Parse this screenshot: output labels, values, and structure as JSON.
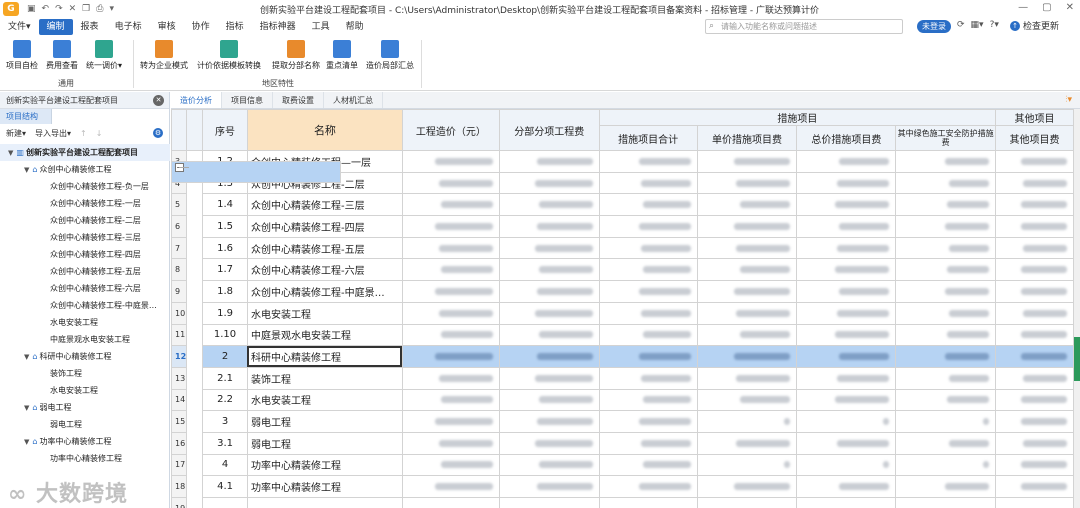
{
  "titlebar": {
    "app_title": "创新实验平台建设工程配套项目 - C:\\Users\\Administrator\\Desktop\\创新实验平台建设工程配套项目备案资料 - 招标管理 - 广联达预算计价"
  },
  "menu": {
    "items": [
      "文件▾",
      "编制",
      "报表",
      "电子标",
      "审核",
      "协作",
      "指标",
      "指标神器",
      "工具",
      "帮助"
    ],
    "active_index": 1
  },
  "search": {
    "placeholder": "请输入功能名称或问题描述"
  },
  "account": {
    "login_label": "未登录",
    "update_label": "检查更新"
  },
  "ribbon": {
    "buttons": [
      "项目自检",
      "费用查看",
      "统一调价▾",
      "转为企业模式",
      "计价依据模板转换",
      "提取分部名称",
      "重点清单",
      "造价局部汇总"
    ],
    "groups": [
      "通用",
      "地区特性"
    ]
  },
  "left_panel": {
    "project_title": "创新实验平台建设工程配套项目",
    "tab_label": "项目结构",
    "toolbar": {
      "new_label": "新建▾",
      "import_label": "导入导出▾"
    },
    "tree": [
      {
        "label": "创新实验平台建设工程配套项目",
        "level": 0,
        "kind": "root"
      },
      {
        "label": "众创中心精装修工程",
        "level": 1,
        "kind": "folder"
      },
      {
        "label": "众创中心精装修工程-负一层",
        "level": 2,
        "kind": "leaf"
      },
      {
        "label": "众创中心精装修工程-一层",
        "level": 2,
        "kind": "leaf"
      },
      {
        "label": "众创中心精装修工程-二层",
        "level": 2,
        "kind": "leaf"
      },
      {
        "label": "众创中心精装修工程-三层",
        "level": 2,
        "kind": "leaf"
      },
      {
        "label": "众创中心精装修工程-四层",
        "level": 2,
        "kind": "leaf"
      },
      {
        "label": "众创中心精装修工程-五层",
        "level": 2,
        "kind": "leaf"
      },
      {
        "label": "众创中心精装修工程-六层",
        "level": 2,
        "kind": "leaf"
      },
      {
        "label": "众创中心精装修工程-中庭景…",
        "level": 2,
        "kind": "leaf"
      },
      {
        "label": "水电安装工程",
        "level": 2,
        "kind": "leaf"
      },
      {
        "label": "中庭景观水电安装工程",
        "level": 2,
        "kind": "leaf"
      },
      {
        "label": "科研中心精装修工程",
        "level": 1,
        "kind": "folder"
      },
      {
        "label": "装饰工程",
        "level": 2,
        "kind": "leaf"
      },
      {
        "label": "水电安装工程",
        "level": 2,
        "kind": "leaf"
      },
      {
        "label": "弱电工程",
        "level": 1,
        "kind": "folder"
      },
      {
        "label": "弱电工程",
        "level": 2,
        "kind": "leaf"
      },
      {
        "label": "功率中心精装修工程",
        "level": 1,
        "kind": "folder"
      },
      {
        "label": "功率中心精装修工程",
        "level": 2,
        "kind": "leaf"
      }
    ]
  },
  "watermark": {
    "text": "大数跨境"
  },
  "right_tabs": [
    "造价分析",
    "项目信息",
    "取费设置",
    "人材机汇总"
  ],
  "grid": {
    "headers": {
      "seq": "序号",
      "name": "名称",
      "cost": "工程造价（元）",
      "subitem": "分部分项工程费",
      "measures_group": "措施项目",
      "measures_total": "措施项目合计",
      "unit_measures": "单价措施项目费",
      "total_measures": "总价措施项目费",
      "safety": "其中绿色施工安全防护措施费",
      "other_group": "其他项目",
      "other": "其他项目费"
    },
    "rows": [
      {
        "rn": "3",
        "seq": "1.2",
        "name": "众创中心精装修工程—一层",
        "group": false
      },
      {
        "rn": "4",
        "seq": "1.3",
        "name": "众创中心精装修工程-二层",
        "group": false
      },
      {
        "rn": "5",
        "seq": "1.4",
        "name": "众创中心精装修工程-三层",
        "group": false
      },
      {
        "rn": "6",
        "seq": "1.5",
        "name": "众创中心精装修工程-四层",
        "group": false
      },
      {
        "rn": "7",
        "seq": "1.6",
        "name": "众创中心精装修工程-五层",
        "group": false
      },
      {
        "rn": "8",
        "seq": "1.7",
        "name": "众创中心精装修工程-六层",
        "group": false
      },
      {
        "rn": "9",
        "seq": "1.8",
        "name": "众创中心精装修工程-中庭景…",
        "group": false
      },
      {
        "rn": "10",
        "seq": "1.9",
        "name": "水电安装工程",
        "group": false
      },
      {
        "rn": "11",
        "seq": "1.10",
        "name": "中庭景观水电安装工程",
        "group": false
      },
      {
        "rn": "12",
        "seq": "2",
        "name": "科研中心精装修工程",
        "group": true,
        "selected": true
      },
      {
        "rn": "13",
        "seq": "2.1",
        "name": "装饰工程",
        "group": false
      },
      {
        "rn": "14",
        "seq": "2.2",
        "name": "水电安装工程",
        "group": false
      },
      {
        "rn": "15",
        "seq": "3",
        "name": "弱电工程",
        "group": true
      },
      {
        "rn": "16",
        "seq": "3.1",
        "name": "弱电工程",
        "group": false
      },
      {
        "rn": "17",
        "seq": "4",
        "name": "功率中心精装修工程",
        "group": true
      },
      {
        "rn": "18",
        "seq": "4.1",
        "name": "功率中心精装修工程",
        "group": false
      },
      {
        "rn": "19",
        "seq": "",
        "name": "",
        "group": false
      }
    ]
  },
  "colors": {
    "accent": "#2a6ec6",
    "name_header": "#fbe3c1",
    "selected_row": "#b6d3f3",
    "scroll_thumb": "#2c9a5b"
  }
}
